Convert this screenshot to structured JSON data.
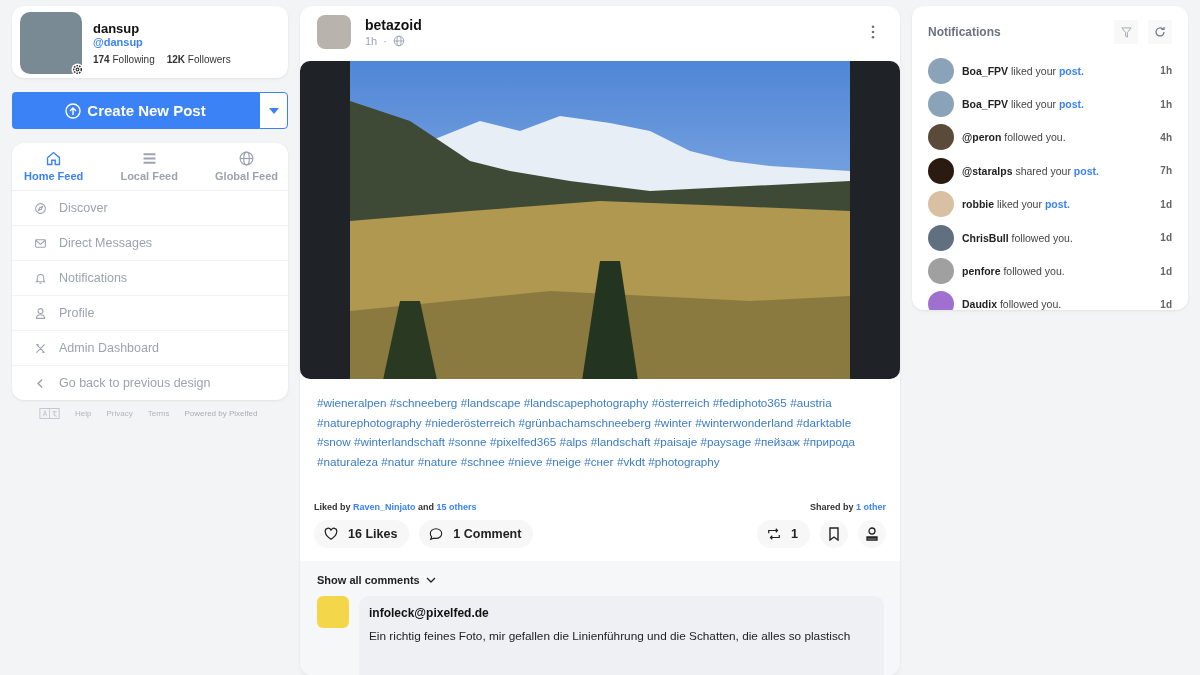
{
  "profile": {
    "name": "dansup",
    "handle": "@dansup",
    "following_count": "174",
    "following_label": "Following",
    "followers_count": "12K",
    "followers_label": "Followers"
  },
  "create_button": {
    "label": "Create New Post"
  },
  "feed_tabs": [
    {
      "label": "Home Feed",
      "selected": true
    },
    {
      "label": "Local Feed",
      "selected": false
    },
    {
      "label": "Global Feed",
      "selected": false
    }
  ],
  "nav_items": [
    "Discover",
    "Direct Messages",
    "Notifications",
    "Profile",
    "Admin Dashboard",
    "Go back to previous design"
  ],
  "footer_links": [
    "Help",
    "Privacy",
    "Terms",
    "Powered by Pixelfed"
  ],
  "post": {
    "author": "betazoid",
    "time": "1h",
    "separator": "·",
    "hashtags": [
      "#wieneralpen",
      "#schneeberg",
      "#landscape",
      "#landscapephotography",
      "#österreich",
      "#fediphoto365",
      "#austria",
      "#naturephotography",
      "#niederösterreich",
      "#grünbachamschneeberg",
      "#winter",
      "#winterwonderland",
      "#darktable",
      "#snow",
      "#winterlandschaft",
      "#sonne",
      "#pixelfed365",
      "#alps",
      "#landschaft",
      "#paisaje",
      "#paysage",
      "#пейзаж",
      "#природа",
      "#naturaleza",
      "#natur",
      "#nature",
      "#schnee",
      "#nieve",
      "#neige",
      "#снег",
      "#vkdt",
      "#photography"
    ],
    "liked_by_prefix": "Liked by",
    "liked_by_user": "Raven_Ninjato",
    "liked_by_and": "and",
    "liked_by_others": "15 others",
    "shared_by_prefix": "Shared by",
    "shared_by_link": "1 other",
    "likes": "16 Likes",
    "comments": "1 Comment",
    "shares": "1",
    "show_comments": "Show all comments",
    "comment": {
      "author": "infoleck@pixelfed.de",
      "text": "Ein richtig feines Foto, mir gefallen die Linienführung und die Schatten, die alles so plastisch"
    }
  },
  "notifications": {
    "title": "Notifications",
    "items": [
      {
        "user": "Boa_FPV",
        "action": "liked your",
        "link": "post.",
        "time": "1h"
      },
      {
        "user": "Boa_FPV",
        "action": "liked your",
        "link": "post.",
        "time": "1h"
      },
      {
        "user": "@peron",
        "action": "followed you.",
        "time": "4h"
      },
      {
        "user": "@staralps",
        "action": "shared your",
        "link": "post.",
        "time": "7h"
      },
      {
        "user": "robbie",
        "action": "liked your",
        "link": "post.",
        "time": "1d"
      },
      {
        "user": "ChrisBull",
        "action": "followed you.",
        "time": "1d"
      },
      {
        "user": "penfore",
        "action": "followed you.",
        "time": "1d"
      },
      {
        "user": "Daudix",
        "action": "followed you.",
        "time": "1d"
      }
    ]
  }
}
